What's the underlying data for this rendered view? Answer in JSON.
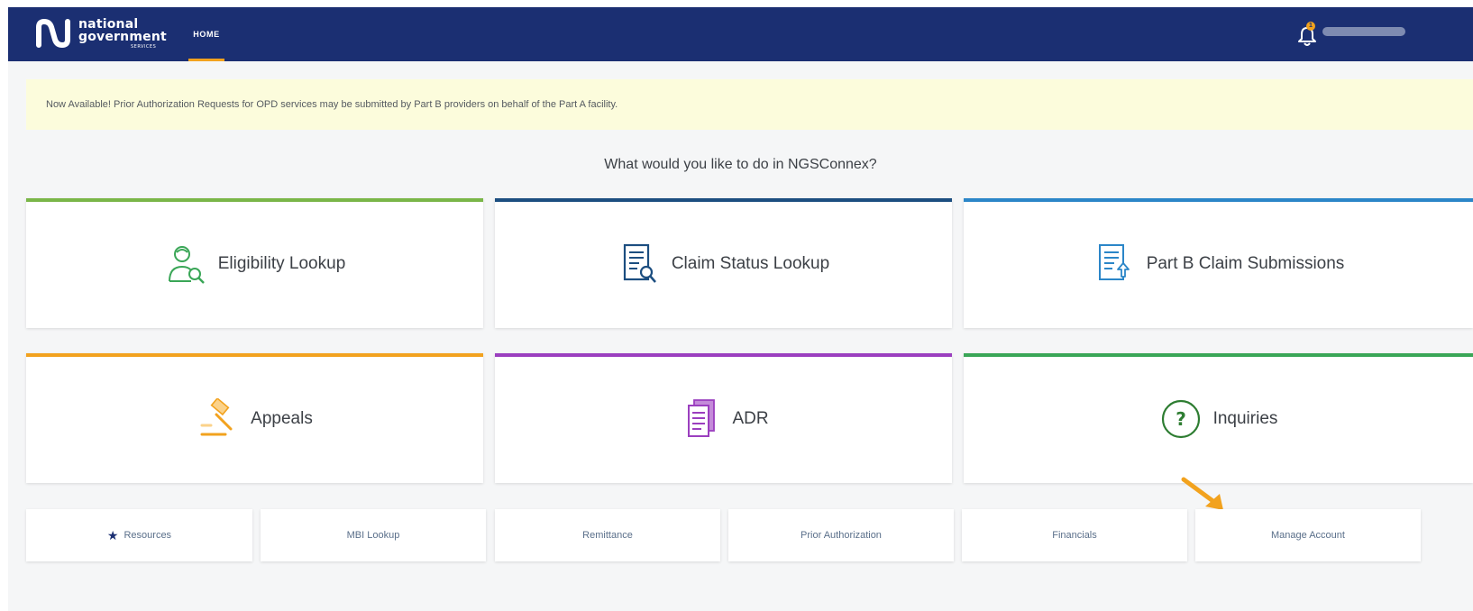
{
  "header": {
    "logo_line1": "national",
    "logo_line2": "government",
    "logo_line3": "SERVICES",
    "nav_home": "HOME",
    "notification_count": "1",
    "brand_color": "#1b2f72",
    "accent_color": "#f2a21e"
  },
  "announcement": {
    "text": "Now Available! Prior Authorization Requests for OPD services may be submitted by Part B providers on behalf of the Part A facility.",
    "background": "#fcfcdc"
  },
  "main": {
    "question": "What would you like to do in NGSConnex?",
    "tiles": [
      {
        "label": "Eligibility Lookup",
        "icon": "person-search-icon",
        "color": "#7ab648"
      },
      {
        "label": "Claim Status Lookup",
        "icon": "document-search-icon",
        "color": "#1c4e80"
      },
      {
        "label": "Part B Claim Submissions",
        "icon": "document-upload-icon",
        "color": "#2b86c8"
      },
      {
        "label": "Appeals",
        "icon": "gavel-icon",
        "color": "#f2a21e"
      },
      {
        "label": "ADR",
        "icon": "document-stack-icon",
        "color": "#9b3fbf"
      },
      {
        "label": "Inquiries",
        "icon": "question-circle-icon",
        "color": "#3aa657"
      }
    ],
    "links": [
      {
        "label": "Resources",
        "icon": "star-icon"
      },
      {
        "label": "MBI Lookup"
      },
      {
        "label": "Remittance"
      },
      {
        "label": "Prior Authorization"
      },
      {
        "label": "Financials"
      },
      {
        "label": "Manage Account"
      }
    ]
  }
}
